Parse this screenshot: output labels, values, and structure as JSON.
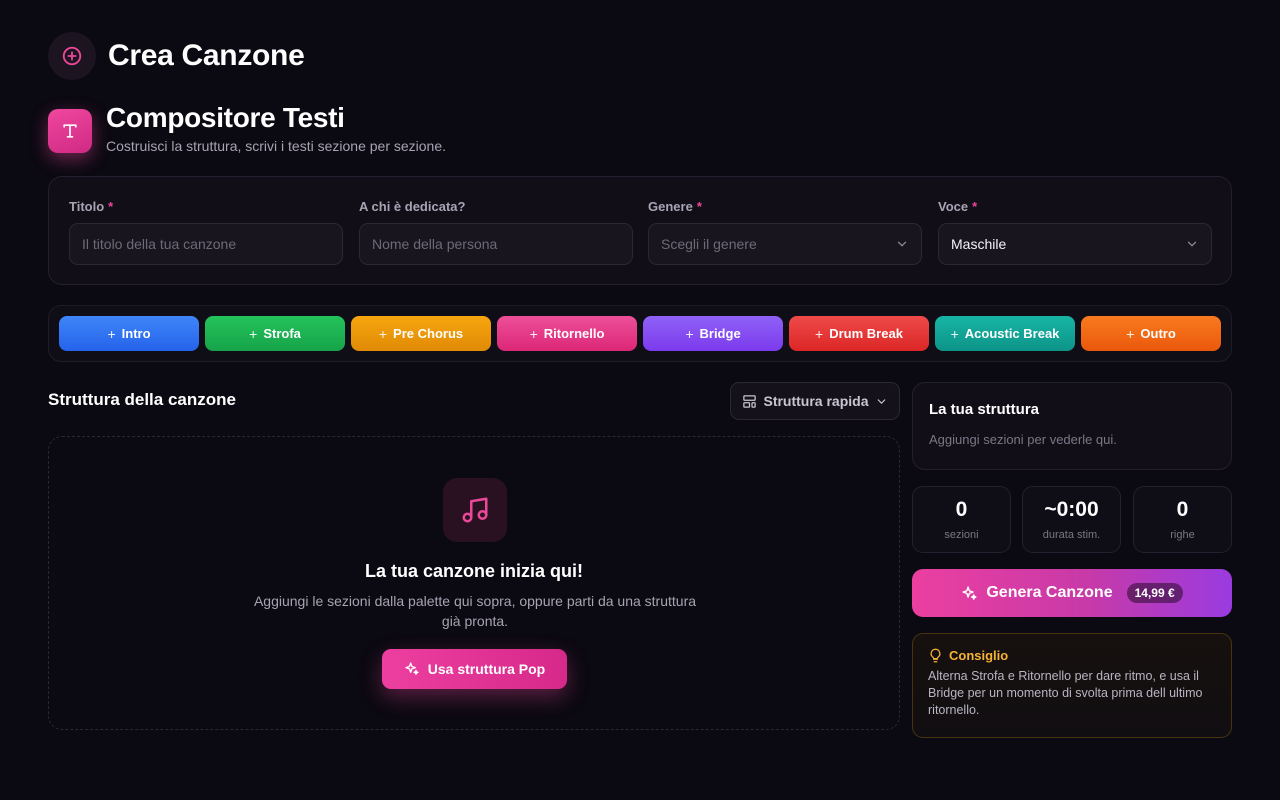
{
  "page": {
    "title": "Crea Canzone"
  },
  "composer": {
    "title": "Compositore Testi",
    "subtitle": "Costruisci la struttura, scrivi i testi sezione per sezione."
  },
  "form": {
    "title": {
      "label": "Titolo",
      "required_mark": "*",
      "placeholder": "Il titolo della tua canzone",
      "value": ""
    },
    "dedication": {
      "label": "A chi è dedicata?",
      "placeholder": "Nome della persona",
      "value": ""
    },
    "genre": {
      "label": "Genere",
      "required_mark": "*",
      "placeholder": "Scegli il genere",
      "value": ""
    },
    "voice": {
      "label": "Voce",
      "required_mark": "*",
      "value": "Maschile"
    }
  },
  "palette": {
    "chips": [
      {
        "label": "Intro",
        "color": "#3b82f6"
      },
      {
        "label": "Strofa",
        "color": "#22c55e"
      },
      {
        "label": "Pre Chorus",
        "color": "#f59e0b"
      },
      {
        "label": "Ritornello",
        "color": "#ec4899"
      },
      {
        "label": "Bridge",
        "color": "#8b5cf6"
      },
      {
        "label": "Drum Break",
        "color": "#ef4444"
      },
      {
        "label": "Acoustic Break",
        "color": "#14b8a6"
      },
      {
        "label": "Outro",
        "color": "#f97316"
      }
    ]
  },
  "structure": {
    "title": "Struttura della canzone",
    "quick_label": "Struttura rapida",
    "empty_title": "La tua canzone inizia qui!",
    "empty_desc": "Aggiungi le sezioni dalla palette qui sopra, oppure parti da una struttura già pronta.",
    "pop_button": "Usa struttura Pop"
  },
  "sidebar": {
    "card_title": "La tua struttura",
    "card_empty": "Aggiungi sezioni per vederle qui.",
    "stats": [
      {
        "value": "0",
        "label": "sezioni"
      },
      {
        "value": "~0:00",
        "label": "durata stim."
      },
      {
        "value": "0",
        "label": "righe"
      }
    ],
    "generate_label": "Genera Canzone",
    "price": "14,99 €",
    "tip_title": "Consiglio",
    "tip_text": "Alterna Strofa e Ritornello per dare ritmo, e usa il Bridge per un momento di svolta prima dell ultimo ritornello."
  },
  "colors": {
    "accent": "#ec4899",
    "background": "#0b0912",
    "tip": "#f5b237"
  }
}
